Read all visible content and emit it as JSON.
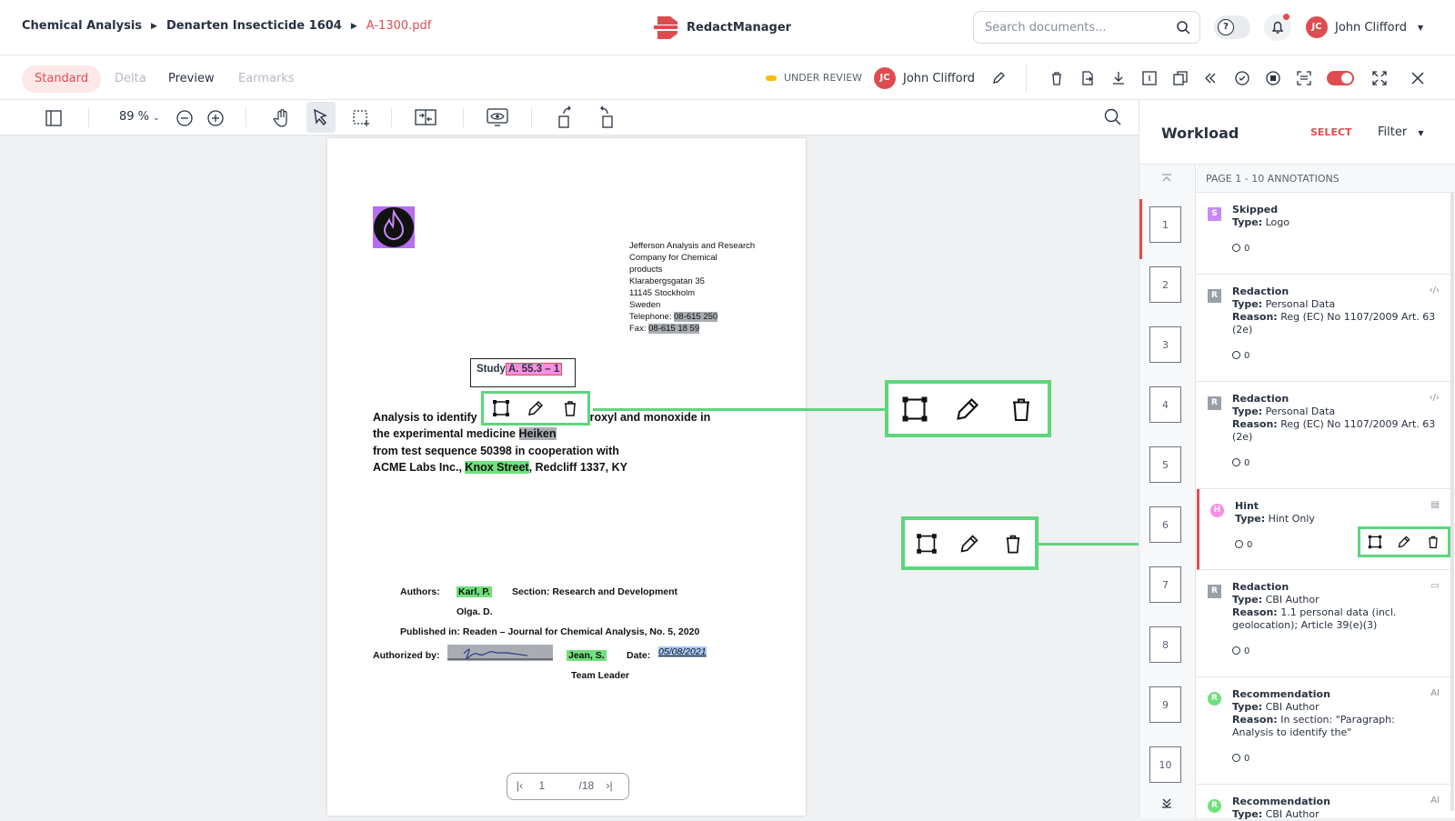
{
  "breadcrumb": {
    "root": "Chemical Analysis",
    "project": "Denarten Insecticide 1604",
    "file": "A-1300.pdf"
  },
  "app": {
    "name": "RedactManager"
  },
  "search": {
    "placeholder": "Search documents..."
  },
  "user": {
    "initials": "JC",
    "name": "John Clifford"
  },
  "tabs": [
    {
      "label": "Standard",
      "state": "active"
    },
    {
      "label": "Delta",
      "state": "disabled"
    },
    {
      "label": "Preview",
      "state": "normal"
    },
    {
      "label": "Earmarks",
      "state": "disabled"
    }
  ],
  "status": {
    "label": "UNDER REVIEW",
    "color": "#fdbd00"
  },
  "assignee": {
    "initials": "JC",
    "name": "John Clifford"
  },
  "viewer": {
    "zoom": "89 %",
    "page_current": "1",
    "page_total": "/18"
  },
  "document": {
    "address": [
      "Jefferson Analysis and Research",
      "Company for Chemical",
      "products",
      "Klarabergsgatan 35",
      "11145 Stockholm",
      "Sweden"
    ],
    "telephone_label": "Telephone:",
    "telephone": "08-615 250",
    "fax_label": "Fax:",
    "fax": "08-615 18 59",
    "study_label": "Study",
    "study_id": "A. 55.3 – 1",
    "title_l1_a": "Analysis to identify",
    "title_l1_b": "roxyl and monoxide in",
    "title_l2_a": "the experimental medicine",
    "title_l2_b": "Heiken",
    "title_l3": "from test sequence 50398 in cooperation with",
    "title_l4_a": "ACME Labs Inc.,",
    "title_l4_b": "Knox Street",
    "title_l4_c": ", Redcliff 1337, KY",
    "authors_label": "Authors:",
    "author1": "Karl, P.",
    "section": "Section: Research and Development",
    "author2": "Olga. D.",
    "published": "Published in: Readen – Journal for Chemical Analysis, No. 5, 2020",
    "authorized_label": "Authorized by:",
    "signer": "Jean, S.",
    "date_label": "Date:",
    "date": "05/08/2021",
    "role": "Team Leader"
  },
  "workload": {
    "title": "Workload",
    "select_label": "SELECT",
    "filter_label": "Filter",
    "page_header": "PAGE 1 - 10 ANNOTATIONS",
    "thumbs": [
      "1",
      "2",
      "3",
      "4",
      "5",
      "6",
      "7",
      "8",
      "9",
      "10"
    ],
    "annotations": [
      {
        "title": "Skipped",
        "type_label": "Type:",
        "type": "Logo",
        "reason": "",
        "count": "0",
        "badge": "S",
        "color": "#c78af5"
      },
      {
        "title": "Redaction",
        "type_label": "Type:",
        "type": "Personal Data",
        "reason_label": "Reason:",
        "reason": "Reg (EC) No 1107/2009 Art. 63 (2e)",
        "count": "0",
        "badge": "R",
        "color": "#9aa0aa"
      },
      {
        "title": "Redaction",
        "type_label": "Type:",
        "type": "Personal Data",
        "reason_label": "Reason:",
        "reason": "Reg (EC) No 1107/2009 Art. 63 (2e)",
        "count": "0",
        "badge": "R",
        "color": "#9aa0aa"
      },
      {
        "title": "Hint",
        "type_label": "Type:",
        "type": "Hint Only",
        "reason": "",
        "count": "0",
        "badge": "H",
        "color": "#f78fe3"
      },
      {
        "title": "Redaction",
        "type_label": "Type:",
        "type": "CBI Author",
        "reason_label": "Reason:",
        "reason": "1.1 personal data (incl. geolocation); Article 39(e)(3)",
        "count": "0",
        "badge": "R",
        "color": "#9aa0aa"
      },
      {
        "title": "Recommendation",
        "type_label": "Type:",
        "type": "CBI Author",
        "reason_label": "Reason:",
        "reason": "In section: \"Paragraph: Analysis to identify the\"",
        "count": "0",
        "badge": "R",
        "color": "#6fe07a",
        "side": "AI"
      },
      {
        "title": "Recommendation",
        "type_label": "Type:",
        "type": "CBI Author",
        "reason": "",
        "count": "",
        "badge": "R",
        "color": "#6fe07a",
        "side": "AI"
      }
    ]
  }
}
